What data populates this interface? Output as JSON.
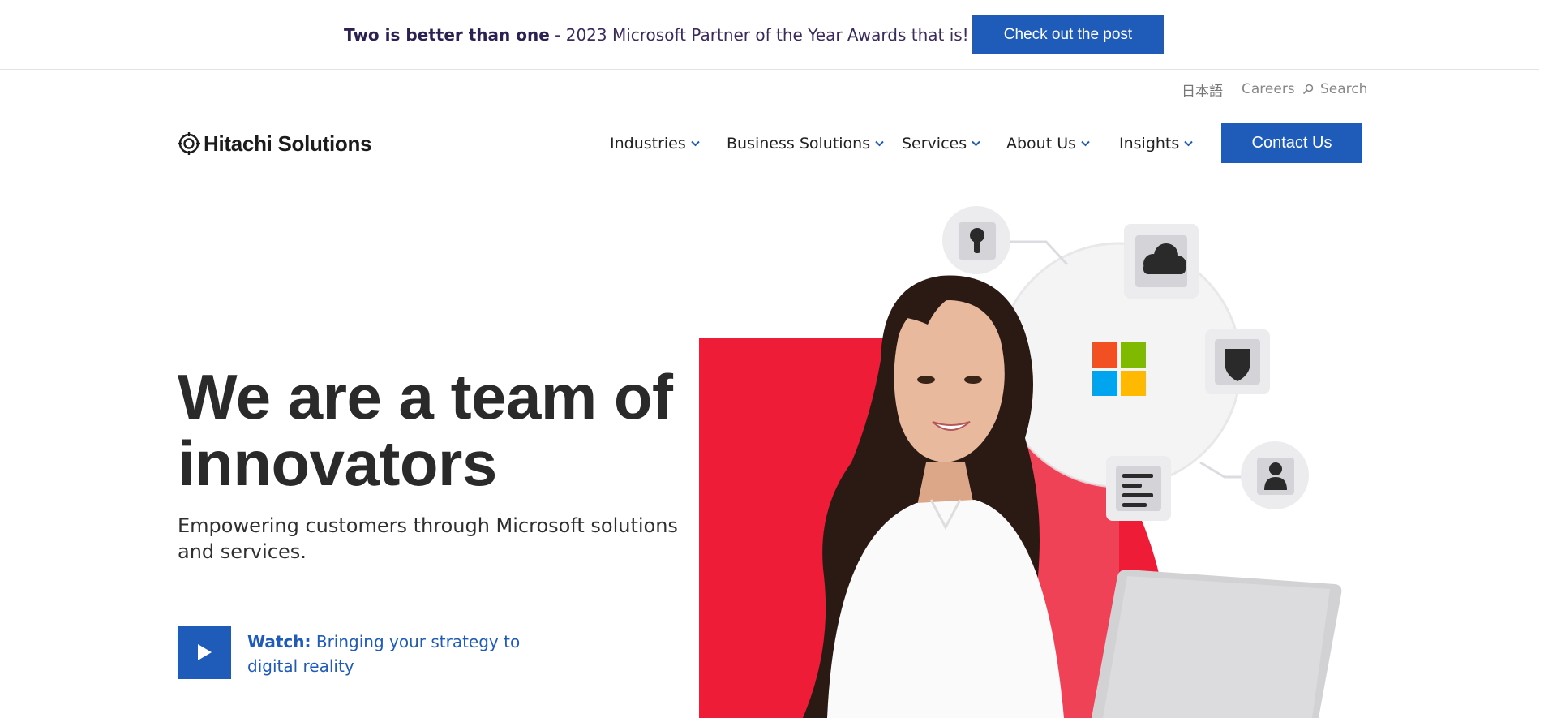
{
  "banner": {
    "bold_text": "Two is better than one",
    "text": " - 2023 Microsoft Partner of the Year Awards that is!",
    "button_label": "Check out the post"
  },
  "utility": {
    "language": "日本語",
    "careers": "Careers",
    "search": "Search"
  },
  "logo": {
    "text": "Hitachi Solutions",
    "icon": "hitachi-logo-icon"
  },
  "nav": {
    "items": [
      {
        "label": "Industries"
      },
      {
        "label": "Business Solutions"
      },
      {
        "label": "Services"
      },
      {
        "label": "About Us"
      },
      {
        "label": "Insights"
      }
    ],
    "contact_label": "Contact Us"
  },
  "hero": {
    "title": "We are a team of innovators",
    "subtitle": "Empowering customers through Microsoft solutions and services.",
    "watch_bold": "Watch:",
    "watch_text": " Bringing your strategy to digital reality"
  },
  "colors": {
    "accent_blue": "#1f5bb8",
    "hero_red": "#ee1c36",
    "ms_red": "#f25022",
    "ms_green": "#7fba00",
    "ms_blue": "#00a4ef",
    "ms_yellow": "#ffb900"
  },
  "icons": [
    "keyhole-icon",
    "cloud-icon",
    "shield-icon",
    "user-icon",
    "document-lines-icon",
    "microsoft-logo-icon",
    "play-icon",
    "search-icon",
    "chevron-down-icon"
  ]
}
